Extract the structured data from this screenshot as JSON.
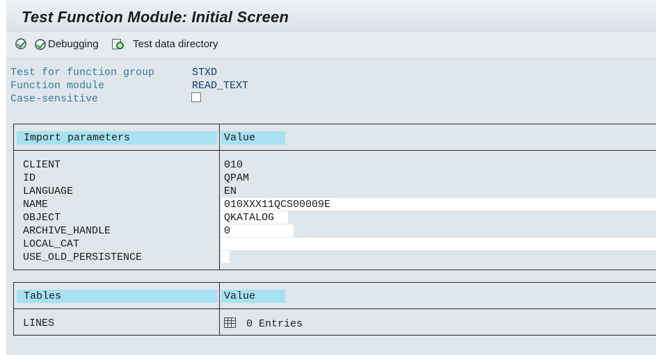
{
  "window": {
    "title": "Test Function Module: Initial Screen"
  },
  "toolbar": {
    "execute_icon": "execute-icon",
    "debugging_label": "Debugging",
    "test_data_directory_label": "Test data directory"
  },
  "fields": {
    "function_group_label": "Test for function group",
    "function_group_value": "STXD",
    "function_module_label": "Function module",
    "function_module_value": "READ_TEXT",
    "case_sensitive_label": "Case-sensitive",
    "case_sensitive_checked": false
  },
  "import_table": {
    "header_name": "Import parameters",
    "header_value": "Value",
    "rows": [
      {
        "name": "CLIENT",
        "value": "010"
      },
      {
        "name": "ID",
        "value": "QPAM"
      },
      {
        "name": "LANGUAGE",
        "value": "EN"
      },
      {
        "name": "NAME",
        "value": "010XXX11QCS00009E"
      },
      {
        "name": "OBJECT",
        "value": "QKATALOG"
      },
      {
        "name": "ARCHIVE_HANDLE",
        "value": "0"
      },
      {
        "name": "LOCAL_CAT",
        "value": ""
      },
      {
        "name": "USE_OLD_PERSISTENCE",
        "value": ""
      }
    ]
  },
  "tables_table": {
    "header_name": "Tables",
    "header_value": "Value",
    "rows": [
      {
        "name": "LINES",
        "value": "0 Entries"
      }
    ]
  },
  "colors": {
    "header_highlight": "#a8e1f1",
    "label_blue": "#3b7c9b",
    "value_blue": "#153d6e",
    "background": "#dfe6ec"
  }
}
